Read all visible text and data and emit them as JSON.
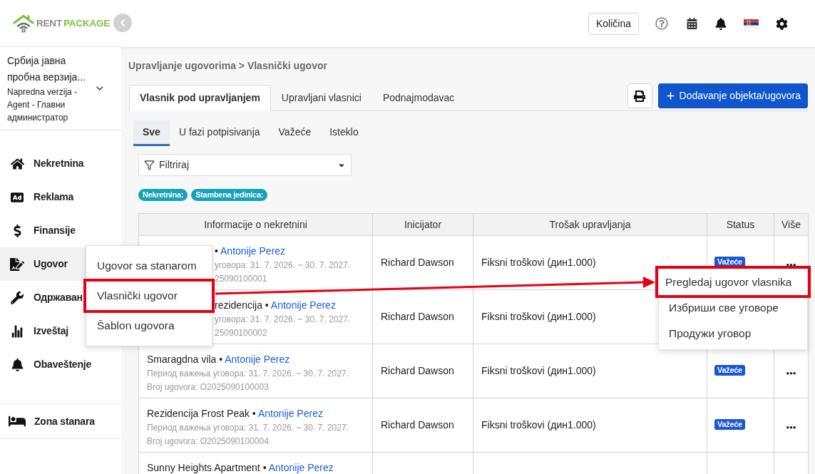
{
  "logo": {
    "name": "RENT",
    "accent": "PACKAGE"
  },
  "header": {
    "quantity_button": "Količina"
  },
  "account": {
    "name": "Србија јавна пробна верзија...",
    "plan": "Napredna verzija - Agent - Главни администратор"
  },
  "sidebar": {
    "items": [
      {
        "label": "Nekretnina",
        "selected": false
      },
      {
        "label": "Reklama",
        "selected": false
      },
      {
        "label": "Finansije",
        "selected": false
      },
      {
        "label": "Ugovor",
        "selected": true
      },
      {
        "label": "Одржаван",
        "selected": false
      },
      {
        "label": "Izveštaj",
        "selected": false
      },
      {
        "label": "Obaveštenje",
        "selected": false
      }
    ],
    "footer_item": {
      "label": "Zona stanara"
    }
  },
  "contract_menu": {
    "items": [
      {
        "label": "Ugovor sa stanarom",
        "highlighted": false
      },
      {
        "label": "Vlasnički ugovor",
        "highlighted": true
      },
      {
        "label": "Šablon ugovora",
        "highlighted": false
      }
    ]
  },
  "breadcrumb": "Upravljanje ugovorima > Vlasnički ugovor",
  "tabs": [
    {
      "label": "Vlasnik pod upravljanjem",
      "selected": true
    },
    {
      "label": "Upravljani vlasnici",
      "selected": false
    },
    {
      "label": "Podnajmodavac",
      "selected": false
    }
  ],
  "add_button": {
    "label": "Dodavanje objekta/ugovora"
  },
  "status_tabs": [
    {
      "label": "Sve",
      "selected": true
    },
    {
      "label": "U fazi potpisivanja",
      "selected": false
    },
    {
      "label": "Važeće",
      "selected": false
    },
    {
      "label": "Isteklo",
      "selected": false
    }
  ],
  "filter": {
    "placeholder": "Filtriraj"
  },
  "tags": [
    "Nekretnina:",
    "Stambena jedinica:"
  ],
  "table": {
    "columns": [
      "Informacije o nekretnini",
      "Inicijator",
      "Trošak upravljanja",
      "Status",
      "Više"
    ],
    "rows": [
      {
        "kind": "covered",
        "name": "•",
        "owner": "Antonije Perez",
        "period": "уговора: 31. 7. 2026. ~ 30. 7. 2027.",
        "number": "25090100001",
        "initiator": "Richard Dawson",
        "cost": "Fiksni troškovi (дин1.000)",
        "status": "Važeće"
      },
      {
        "kind": "covered",
        "name": "rezidencija •",
        "owner": "Antonije Perez",
        "period": "уговора: 31. 7. 2026. ~ 30. 7. 2027.",
        "number": "25090100002",
        "initiator": "Richard Dawson",
        "cost": "Fiksni troškovi (дин1.000)"
      },
      {
        "kind": "plain",
        "name": "Smaragdna vila •",
        "owner": "Antonije Perez",
        "period": "Период важења уговора: 31. 7. 2026. ~ 30. 7. 2027.",
        "number": "Broj ugovora: O2025090100003",
        "initiator": "Richard Dawson",
        "cost": "Fiksni troškovi (дин1.000)",
        "status": "Važeće"
      },
      {
        "kind": "plain",
        "name": "Rezidencija Frost Peak •",
        "owner": "Antonije Perez",
        "period": "Период важења уговора: 31. 7. 2026. ~ 30. 7. 2027.",
        "number": "Broj ugovora: O2025090100004",
        "initiator": "Richard Dawson",
        "cost": "Fiksni troškovi (дин1.000)",
        "status": "Važeće"
      },
      {
        "kind": "plain",
        "name": "Sunny Heights Apartment •",
        "owner": "Antonije Perez"
      }
    ]
  },
  "row_menu": {
    "items": [
      {
        "label": "Pregledaj ugovor vlasnika",
        "highlighted": true
      },
      {
        "label": "Избриши све уговоре",
        "highlighted": false
      },
      {
        "label": "Продужи уговор",
        "highlighted": false
      }
    ]
  }
}
